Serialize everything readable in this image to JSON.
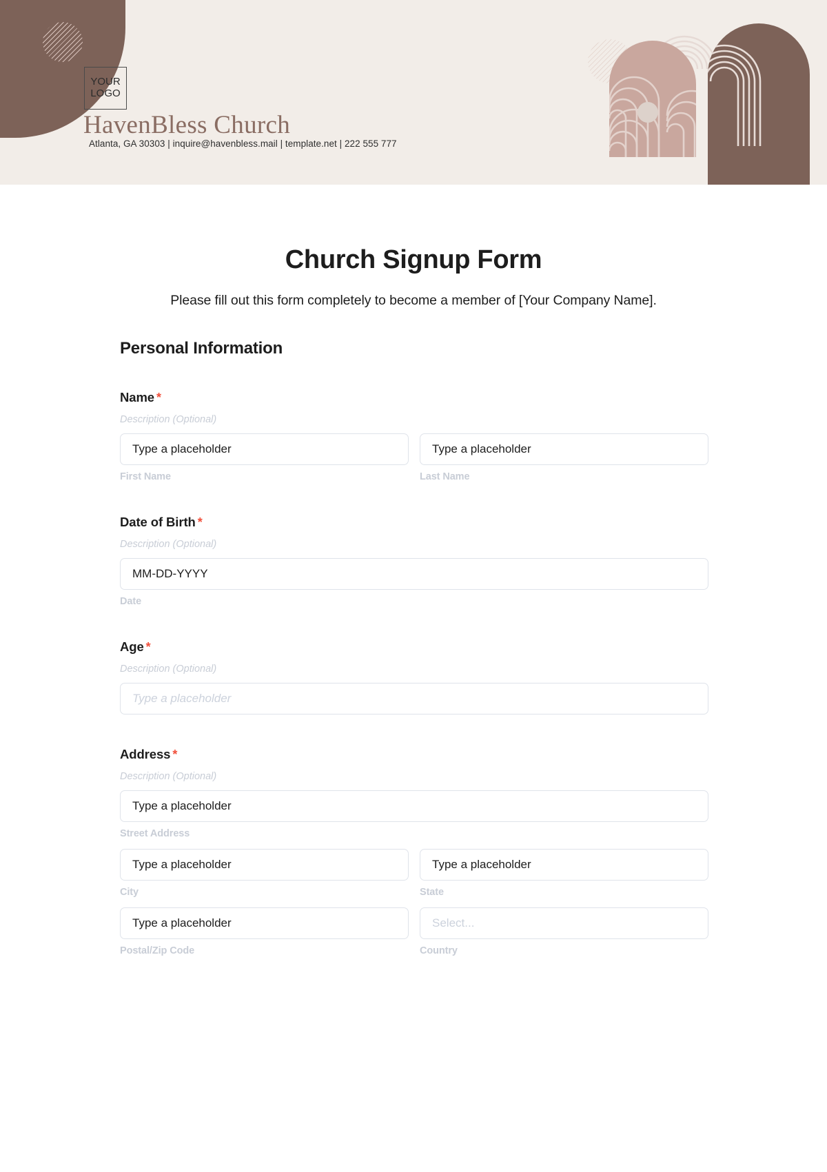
{
  "header": {
    "logo_line1": "YOUR",
    "logo_line2": "LOGO",
    "brand_name": "HavenBless Church",
    "contact": "Atlanta, GA 30303 | inquire@havenbless.mail | template.net | 222 555 777"
  },
  "form": {
    "title": "Church Signup Form",
    "subtitle": "Please fill out this form completely to become a member of [Your Company Name].",
    "section_heading": "Personal Information",
    "required_marker": "*",
    "description_text": "Description (Optional)",
    "fields": [
      {
        "label": "Name",
        "description": "Description (Optional)",
        "inputs": [
          {
            "value": "Type a placeholder",
            "sub_label": "First Name",
            "style": "filled"
          },
          {
            "value": "Type a placeholder",
            "sub_label": "Last Name",
            "style": "filled"
          }
        ]
      },
      {
        "label": "Date of Birth",
        "description": "Description (Optional)",
        "inputs": [
          {
            "value": "MM-DD-YYYY",
            "sub_label": "Date",
            "style": "filled"
          }
        ]
      },
      {
        "label": "Age",
        "description": "Description (Optional)",
        "inputs": [
          {
            "value": "Type a placeholder",
            "sub_label": "",
            "style": "placeholder"
          }
        ]
      },
      {
        "label": "Address",
        "description": "Description (Optional)",
        "inputs": [
          {
            "value": "Type a placeholder",
            "sub_label": "Street Address",
            "style": "filled"
          },
          {
            "value": "Type a placeholder",
            "sub_label": "City",
            "style": "filled"
          },
          {
            "value": "Type a placeholder",
            "sub_label": "State",
            "style": "filled"
          },
          {
            "value": "Type a placeholder",
            "sub_label": "Postal/Zip Code",
            "style": "filled"
          },
          {
            "value": "Select...",
            "sub_label": "Country",
            "style": "select"
          }
        ]
      }
    ]
  },
  "colors": {
    "header_bg": "#f2ede8",
    "dark_brown": "#7d6258",
    "dusty_rose": "#c9a79e",
    "brand_text": "#8a6d63",
    "required_red": "#f1503c",
    "label_gray": "#c8cdd6",
    "border_gray": "#dfe3ea"
  }
}
